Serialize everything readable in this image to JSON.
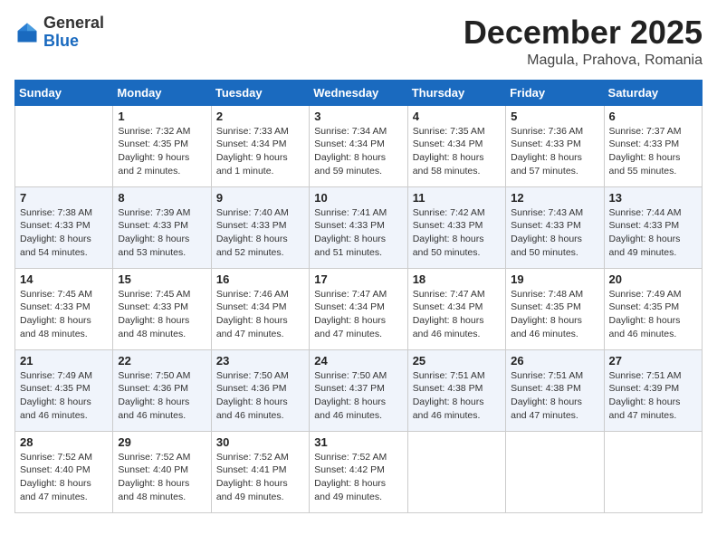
{
  "logo": {
    "general": "General",
    "blue": "Blue"
  },
  "title": "December 2025",
  "subtitle": "Magula, Prahova, Romania",
  "days_of_week": [
    "Sunday",
    "Monday",
    "Tuesday",
    "Wednesday",
    "Thursday",
    "Friday",
    "Saturday"
  ],
  "weeks": [
    [
      {
        "day": "",
        "content": ""
      },
      {
        "day": "1",
        "content": "Sunrise: 7:32 AM\nSunset: 4:35 PM\nDaylight: 9 hours\nand 2 minutes."
      },
      {
        "day": "2",
        "content": "Sunrise: 7:33 AM\nSunset: 4:34 PM\nDaylight: 9 hours\nand 1 minute."
      },
      {
        "day": "3",
        "content": "Sunrise: 7:34 AM\nSunset: 4:34 PM\nDaylight: 8 hours\nand 59 minutes."
      },
      {
        "day": "4",
        "content": "Sunrise: 7:35 AM\nSunset: 4:34 PM\nDaylight: 8 hours\nand 58 minutes."
      },
      {
        "day": "5",
        "content": "Sunrise: 7:36 AM\nSunset: 4:33 PM\nDaylight: 8 hours\nand 57 minutes."
      },
      {
        "day": "6",
        "content": "Sunrise: 7:37 AM\nSunset: 4:33 PM\nDaylight: 8 hours\nand 55 minutes."
      }
    ],
    [
      {
        "day": "7",
        "content": "Sunrise: 7:38 AM\nSunset: 4:33 PM\nDaylight: 8 hours\nand 54 minutes."
      },
      {
        "day": "8",
        "content": "Sunrise: 7:39 AM\nSunset: 4:33 PM\nDaylight: 8 hours\nand 53 minutes."
      },
      {
        "day": "9",
        "content": "Sunrise: 7:40 AM\nSunset: 4:33 PM\nDaylight: 8 hours\nand 52 minutes."
      },
      {
        "day": "10",
        "content": "Sunrise: 7:41 AM\nSunset: 4:33 PM\nDaylight: 8 hours\nand 51 minutes."
      },
      {
        "day": "11",
        "content": "Sunrise: 7:42 AM\nSunset: 4:33 PM\nDaylight: 8 hours\nand 50 minutes."
      },
      {
        "day": "12",
        "content": "Sunrise: 7:43 AM\nSunset: 4:33 PM\nDaylight: 8 hours\nand 50 minutes."
      },
      {
        "day": "13",
        "content": "Sunrise: 7:44 AM\nSunset: 4:33 PM\nDaylight: 8 hours\nand 49 minutes."
      }
    ],
    [
      {
        "day": "14",
        "content": "Sunrise: 7:45 AM\nSunset: 4:33 PM\nDaylight: 8 hours\nand 48 minutes."
      },
      {
        "day": "15",
        "content": "Sunrise: 7:45 AM\nSunset: 4:33 PM\nDaylight: 8 hours\nand 48 minutes."
      },
      {
        "day": "16",
        "content": "Sunrise: 7:46 AM\nSunset: 4:34 PM\nDaylight: 8 hours\nand 47 minutes."
      },
      {
        "day": "17",
        "content": "Sunrise: 7:47 AM\nSunset: 4:34 PM\nDaylight: 8 hours\nand 47 minutes."
      },
      {
        "day": "18",
        "content": "Sunrise: 7:47 AM\nSunset: 4:34 PM\nDaylight: 8 hours\nand 46 minutes."
      },
      {
        "day": "19",
        "content": "Sunrise: 7:48 AM\nSunset: 4:35 PM\nDaylight: 8 hours\nand 46 minutes."
      },
      {
        "day": "20",
        "content": "Sunrise: 7:49 AM\nSunset: 4:35 PM\nDaylight: 8 hours\nand 46 minutes."
      }
    ],
    [
      {
        "day": "21",
        "content": "Sunrise: 7:49 AM\nSunset: 4:35 PM\nDaylight: 8 hours\nand 46 minutes."
      },
      {
        "day": "22",
        "content": "Sunrise: 7:50 AM\nSunset: 4:36 PM\nDaylight: 8 hours\nand 46 minutes."
      },
      {
        "day": "23",
        "content": "Sunrise: 7:50 AM\nSunset: 4:36 PM\nDaylight: 8 hours\nand 46 minutes."
      },
      {
        "day": "24",
        "content": "Sunrise: 7:50 AM\nSunset: 4:37 PM\nDaylight: 8 hours\nand 46 minutes."
      },
      {
        "day": "25",
        "content": "Sunrise: 7:51 AM\nSunset: 4:38 PM\nDaylight: 8 hours\nand 46 minutes."
      },
      {
        "day": "26",
        "content": "Sunrise: 7:51 AM\nSunset: 4:38 PM\nDaylight: 8 hours\nand 47 minutes."
      },
      {
        "day": "27",
        "content": "Sunrise: 7:51 AM\nSunset: 4:39 PM\nDaylight: 8 hours\nand 47 minutes."
      }
    ],
    [
      {
        "day": "28",
        "content": "Sunrise: 7:52 AM\nSunset: 4:40 PM\nDaylight: 8 hours\nand 47 minutes."
      },
      {
        "day": "29",
        "content": "Sunrise: 7:52 AM\nSunset: 4:40 PM\nDaylight: 8 hours\nand 48 minutes."
      },
      {
        "day": "30",
        "content": "Sunrise: 7:52 AM\nSunset: 4:41 PM\nDaylight: 8 hours\nand 49 minutes."
      },
      {
        "day": "31",
        "content": "Sunrise: 7:52 AM\nSunset: 4:42 PM\nDaylight: 8 hours\nand 49 minutes."
      },
      {
        "day": "",
        "content": ""
      },
      {
        "day": "",
        "content": ""
      },
      {
        "day": "",
        "content": ""
      }
    ]
  ]
}
